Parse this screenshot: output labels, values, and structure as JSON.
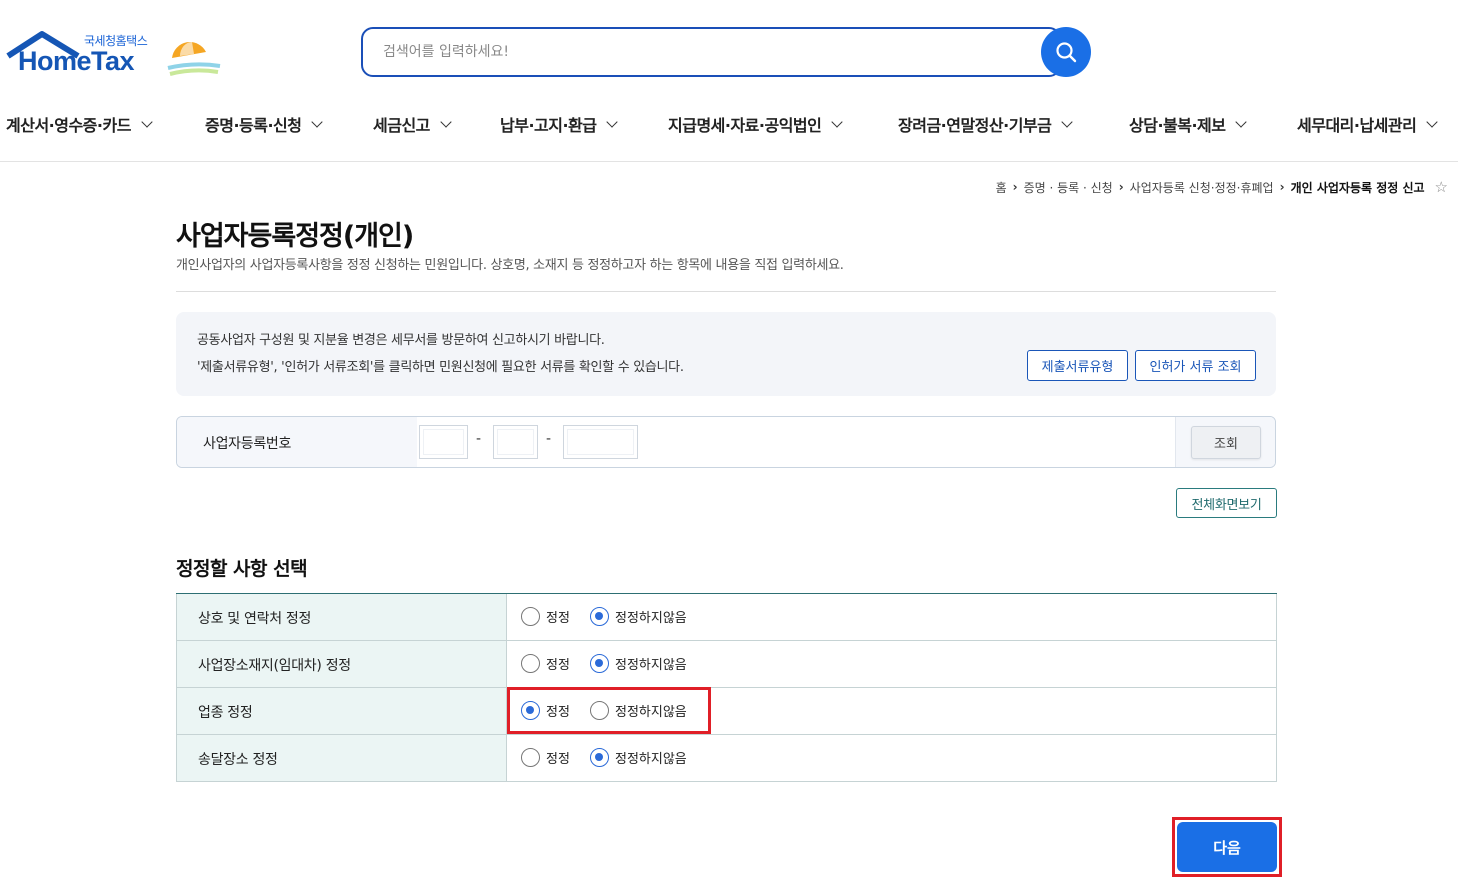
{
  "header": {
    "logo_kr": "국세청홈택스",
    "logo_en": "HomeTax",
    "search_placeholder": "검색어를 입력하세요!"
  },
  "gnb": [
    {
      "label": "계산서·영수증·카드"
    },
    {
      "label": "증명·등록·신청"
    },
    {
      "label": "세금신고"
    },
    {
      "label": "납부·고지·환급"
    },
    {
      "label": "지급명세·자료·공익법인"
    },
    {
      "label": "장려금·연말정산·기부금"
    },
    {
      "label": "상담·불복·제보"
    },
    {
      "label": "세무대리·납세관리"
    }
  ],
  "breadcrumb": {
    "items": [
      "홈",
      "증명 · 등록 · 신청",
      "사업자등록 신청·정정·휴폐업"
    ],
    "current": "개인 사업자등록 정정 신고"
  },
  "page": {
    "title": "사업자등록정정(개인)",
    "description": "개인사업자의 사업자등록사항을 정정 신청하는 민원입니다. 상호명, 소재지 등 정정하고자 하는 항목에 내용을 직접 입력하세요."
  },
  "notice": {
    "line1": "공동사업자 구성원 및 지분율 변경은 세무서를 방문하여 신고하시기 바랍니다.",
    "line2": "'제출서류유형', '인허가 서류조회'를 클릭하면 민원신청에 필요한 서류를 확인할 수 있습니다.",
    "btn_docs": "제출서류유형",
    "btn_permit": "인허가 서류 조회"
  },
  "registration": {
    "label": "사업자등록번호",
    "dash": "-",
    "query_label": "조회"
  },
  "fullview_label": "전체화면보기",
  "section": {
    "title": "정정할 사항 선택",
    "option_correct": "정정",
    "option_no": "정정하지않음",
    "rows": [
      {
        "label": "상호 및 연락처 정정",
        "selected": "정정하지않음"
      },
      {
        "label": "사업장소재지(임대차) 정정",
        "selected": "정정하지않음"
      },
      {
        "label": "업종 정정",
        "selected": "정정"
      },
      {
        "label": "송달장소 정정",
        "selected": "정정하지않음"
      }
    ]
  },
  "next_label": "다음"
}
